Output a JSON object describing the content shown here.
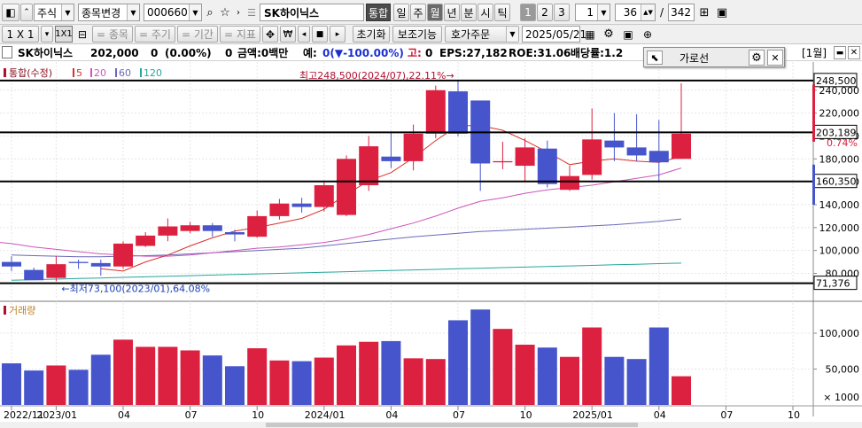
{
  "toolbar1": {
    "market": "주식",
    "change_label": "종목변경",
    "code": "000660",
    "name": "SK하이닉스",
    "tonghap": "통합",
    "periods": [
      "일",
      "주",
      "월",
      "년",
      "분",
      "시",
      "틱"
    ],
    "periods_active": "월",
    "nums": [
      "1",
      "2",
      "3"
    ],
    "unit_value": "1",
    "count_value": "36",
    "total": "342",
    "slash": "/"
  },
  "toolbar2": {
    "ratio1": "1 X 1",
    "ratio2": "1X1",
    "add_stock": "= 종목",
    "add_period": "= 주기",
    "add_range": "= 기간",
    "add_indicator": "= 지표",
    "reset": "초기화",
    "aux": "보조기능",
    "order": "호가주문",
    "date": "2025/05/21"
  },
  "info": {
    "name": "SK하이닉스",
    "price": "202,000",
    "change": "0",
    "rate": "(0.00%)",
    "volume": "0",
    "amount": "금액:0백만",
    "expect_label": "예:",
    "expect_val": "0(▼-100.00%)",
    "high_label": "고:",
    "high_val": "0",
    "eps": "EPS:27,182",
    "roe": "ROE:31.06",
    "div": "배당률:1.2",
    "period_label": "[1월]"
  },
  "popup": {
    "title": "가로선"
  },
  "colors": {
    "up": "#dc2040",
    "down": "#4655cc",
    "ma5": "#d8302a",
    "ma20": "#cc55bb",
    "ma60": "#6a6ab8",
    "ma120": "#26a69a"
  },
  "chart_data": {
    "type": "candlestick",
    "period": "monthly",
    "legend": {
      "title": "통합(수정)",
      "ma": [
        "5",
        "20",
        "60",
        "120"
      ]
    },
    "volume_label": "거래량",
    "x": [
      "2022-11",
      "2022-12",
      "2023-01",
      "2023-02",
      "2023-03",
      "2023-04",
      "2023-05",
      "2023-06",
      "2023-07",
      "2023-08",
      "2023-09",
      "2023-10",
      "2023-11",
      "2023-12",
      "2024-01",
      "2024-02",
      "2024-03",
      "2024-04",
      "2024-05",
      "2024-06",
      "2024-07",
      "2024-08",
      "2024-09",
      "2024-10",
      "2024-11",
      "2024-12",
      "2025-01",
      "2025-02",
      "2025-03",
      "2025-04",
      "2025-05"
    ],
    "open": [
      90000,
      83000,
      76000,
      90000,
      89000,
      86000,
      104000,
      113000,
      117000,
      122000,
      116000,
      112000,
      130000,
      141000,
      138000,
      131000,
      157000,
      182000,
      178000,
      202000,
      239000,
      231000,
      177000,
      174000,
      189000,
      153000,
      166000,
      196000,
      190000,
      187000,
      180000
    ],
    "close": [
      86000,
      74000,
      88000,
      89000,
      86000,
      106000,
      113000,
      121000,
      122000,
      117000,
      114000,
      130000,
      141000,
      138000,
      157000,
      180000,
      191000,
      178000,
      202000,
      240000,
      202000,
      176000,
      178000,
      190000,
      158000,
      165000,
      197000,
      190000,
      183000,
      177000,
      202000
    ],
    "high": [
      95000,
      85000,
      95000,
      92000,
      92000,
      108000,
      116000,
      128000,
      125000,
      124000,
      118000,
      135000,
      145000,
      146000,
      160000,
      183000,
      200000,
      204000,
      210000,
      244000,
      248500,
      203000,
      195000,
      198000,
      196000,
      174000,
      224000,
      220000,
      219000,
      214000,
      246000
    ],
    "low": [
      82000,
      76000,
      73100,
      84000,
      78000,
      84000,
      103000,
      108000,
      115000,
      112000,
      108000,
      111000,
      127000,
      133000,
      134000,
      130000,
      152000,
      172000,
      170000,
      198000,
      200000,
      152000,
      171000,
      160000,
      155000,
      152000,
      162000,
      178000,
      178000,
      161000,
      180000
    ],
    "volume": [
      58000,
      48000,
      55000,
      49000,
      70000,
      91000,
      81000,
      81000,
      76000,
      69000,
      54000,
      79000,
      62000,
      61000,
      66000,
      83000,
      88000,
      89000,
      65000,
      64000,
      118000,
      133000,
      106000,
      84000,
      80000,
      67000,
      108000,
      67000,
      64000,
      108000,
      40000
    ],
    "ma5": [
      null,
      null,
      null,
      null,
      84000,
      82000,
      90000,
      96000,
      104000,
      111000,
      117000,
      120000,
      124000,
      128000,
      136000,
      149000,
      161000,
      168000,
      181000,
      196000,
      209000,
      209000,
      205000,
      196000,
      186000,
      175000,
      178000,
      180000,
      178000,
      177000,
      182000
    ],
    "ma20": [
      106000,
      103000,
      101000,
      99000,
      97000,
      96000,
      95000,
      95000,
      96000,
      98000,
      100000,
      102000,
      103000,
      105000,
      107000,
      110000,
      114000,
      119000,
      124000,
      130000,
      137000,
      143000,
      146000,
      150000,
      153000,
      155000,
      157000,
      160000,
      163000,
      166000,
      172000
    ],
    "ma60": [
      96000,
      95500,
      95000,
      94500,
      94500,
      95000,
      95500,
      96000,
      97000,
      98000,
      99000,
      100000,
      101000,
      102000,
      104000,
      106000,
      108000,
      110000,
      112000,
      113500,
      115000,
      116500,
      117500,
      118500,
      119500,
      120500,
      121500,
      122500,
      124000,
      125500,
      127500
    ],
    "ma120": [
      74000,
      74500,
      75000,
      75500,
      76000,
      76500,
      77000,
      77500,
      78000,
      78500,
      79000,
      79500,
      80000,
      80500,
      81000,
      81500,
      82000,
      82500,
      83000,
      83500,
      84000,
      84500,
      85000,
      85500,
      86000,
      86500,
      87000,
      87500,
      88000,
      88500,
      89000
    ],
    "y_ticks": [
      80000,
      100000,
      120000,
      140000,
      160000,
      180000,
      200000,
      220000,
      240000
    ],
    "y_tick_labels": [
      "80,000",
      "100,000",
      "120,000",
      "140,000",
      "160,000",
      "180,000",
      "200,000",
      "220,000",
      "240,000"
    ],
    "ylim": [
      68000,
      253000
    ],
    "vol_ticks": [
      50000,
      100000
    ],
    "vol_tick_labels": [
      "50,000",
      "100,000"
    ],
    "vol_unit": "× 1000",
    "vol_ylim": [
      0,
      142000
    ],
    "x_ticks": [
      {
        "i": 0,
        "label": "2022/11"
      },
      {
        "i": 2,
        "label": "2023/01"
      },
      {
        "i": 5,
        "label": "04"
      },
      {
        "i": 8,
        "label": "07"
      },
      {
        "i": 11,
        "label": "10"
      },
      {
        "i": 14,
        "label": "2024/01"
      },
      {
        "i": 17,
        "label": "04"
      },
      {
        "i": 20,
        "label": "07"
      },
      {
        "i": 23,
        "label": "10"
      },
      {
        "i": 26,
        "label": "2025/01"
      },
      {
        "i": 29,
        "label": "04"
      },
      {
        "i": 32,
        "label": "07"
      },
      {
        "i": 35,
        "label": "10"
      }
    ],
    "h_lines": [
      {
        "value": 248500,
        "label": "248,500"
      },
      {
        "value": 203189,
        "label": "203,189"
      },
      {
        "value": 160350,
        "label": "160,350"
      },
      {
        "value": 71376,
        "label": "71,376"
      }
    ],
    "side_pct": "0.74%",
    "annotations": {
      "high": "최고248,500(2024/07),22.11%→",
      "low": "←최저73,100(2023/01),64.08%"
    }
  }
}
